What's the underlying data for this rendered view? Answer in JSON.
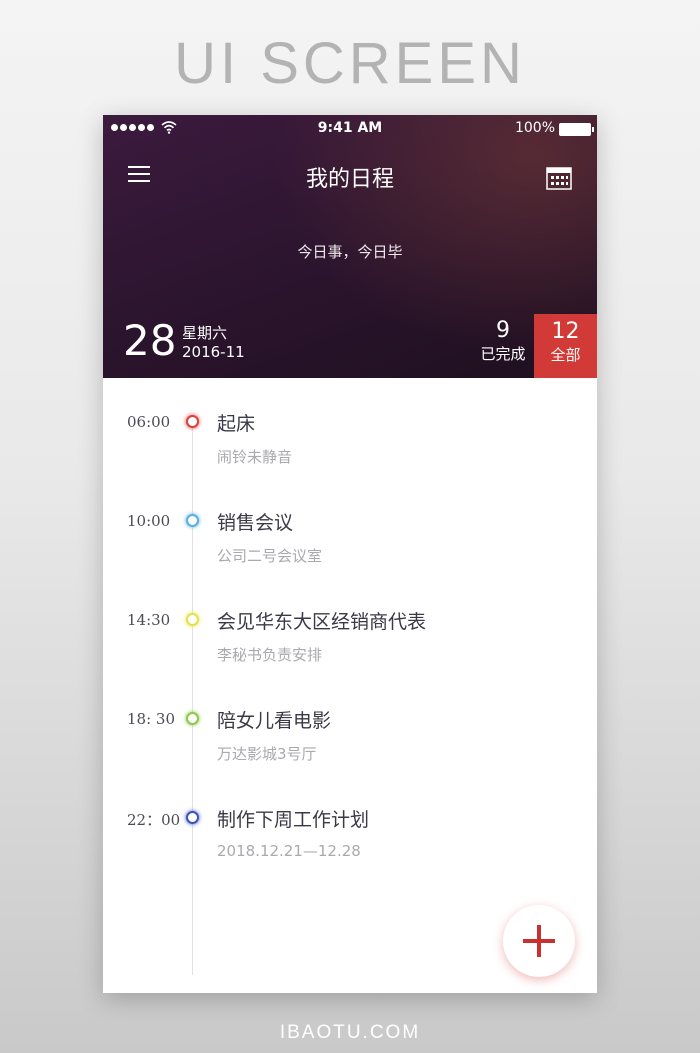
{
  "banner": {
    "title": "UI SCREEN"
  },
  "footer": {
    "url": "IBAOTU.COM"
  },
  "status_bar": {
    "time": "9:41 AM",
    "battery": "100%"
  },
  "header": {
    "title": "我的日程",
    "motto": "今日事，今日毕",
    "date_day": "28",
    "weekday": "星期六",
    "year_month": "2016-11",
    "completed_count": "9",
    "completed_label": "已完成",
    "total_count": "12",
    "total_label": "全部"
  },
  "colors": {
    "accent": "#d23a37",
    "dot_red": "#d9443f",
    "dot_blue": "#5aaee0",
    "dot_yellow": "#e4e24a",
    "dot_green": "#8fc74a",
    "dot_navy": "#3d55b8"
  },
  "events": [
    {
      "time": "06:00",
      "title": "起床",
      "subtitle": "闹铃未静音",
      "dot_color": "#d9443f"
    },
    {
      "time": "10:00",
      "title": "销售会议",
      "subtitle": "公司二号会议室",
      "dot_color": "#5aaee0"
    },
    {
      "time": "14:30",
      "title": "会见华东大区经销商代表",
      "subtitle": "李秘书负责安排",
      "dot_color": "#e4e24a"
    },
    {
      "time": "18: 30",
      "title": "陪女儿看电影",
      "subtitle": "万达影城3号厅",
      "dot_color": "#8fc74a"
    },
    {
      "time": "22：00",
      "title": "制作下周工作计划",
      "subtitle": "2018.12.21—12.28",
      "dot_color": "#3d55b8"
    }
  ],
  "icons": {
    "menu": "hamburger-menu-icon",
    "calendar": "calendar-icon",
    "add": "plus-icon"
  }
}
